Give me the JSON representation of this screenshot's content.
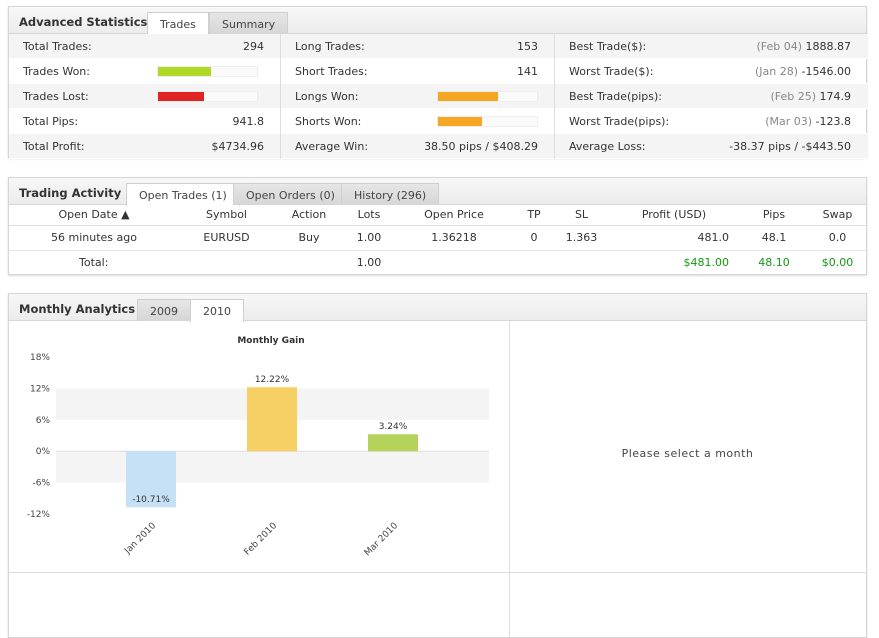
{
  "stats": {
    "title": "Advanced Statistics",
    "tabs": [
      "Trades",
      "Summary"
    ],
    "col1": [
      {
        "label": "Total Trades:",
        "value": "294"
      },
      {
        "label": "Trades Won:",
        "bar": 0.54,
        "color": "#b0d826"
      },
      {
        "label": "Trades Lost:",
        "bar": 0.46,
        "color": "#e02424"
      },
      {
        "label": "Total Pips:",
        "value": "941.8"
      },
      {
        "label": "Total Profit:",
        "value": "$4734.96"
      }
    ],
    "col2": [
      {
        "label": "Long Trades:",
        "value": "153"
      },
      {
        "label": "Short Trades:",
        "value": "141"
      },
      {
        "label": "Longs Won:",
        "bar": 0.61,
        "color": "#f5a623"
      },
      {
        "label": "Shorts Won:",
        "bar": 0.44,
        "color": "#f5a623"
      },
      {
        "label": "Average Win:",
        "value": "38.50 pips / $408.29"
      }
    ],
    "col3": [
      {
        "label": "Best Trade($):",
        "date": "(Feb 04)",
        "value": "1888.87"
      },
      {
        "label": "Worst Trade($):",
        "date": "(Jan 28)",
        "value": "-1546.00"
      },
      {
        "label": "Best Trade(pips):",
        "date": "(Feb 25)",
        "value": "174.9"
      },
      {
        "label": "Worst Trade(pips):",
        "date": "(Mar 03)",
        "value": "-123.8"
      },
      {
        "label": "Average Loss:",
        "value": "-38.37 pips / -$443.50"
      }
    ]
  },
  "activity": {
    "title": "Trading Activity",
    "tabs": [
      "Open Trades (1)",
      "Open Orders (0)",
      "History (296)"
    ],
    "columns": [
      "Open Date ▲",
      "Symbol",
      "Action",
      "Lots",
      "Open Price",
      "TP",
      "SL",
      "Profit (USD)",
      "Pips",
      "Swap"
    ],
    "rows": [
      [
        "56 minutes ago",
        "EURUSD",
        "Buy",
        "1.00",
        "1.36218",
        "0",
        "1.363",
        "481.0",
        "48.1",
        "0.0"
      ]
    ],
    "total": {
      "label": "Total:",
      "lots": "1.00",
      "profit": "$481.00",
      "pips": "48.10",
      "swap": "$0.00"
    }
  },
  "monthly": {
    "title": "Monthly Analytics",
    "tabs": [
      "2009",
      "2010"
    ],
    "placeholder": "Please select a month"
  },
  "chart_data": {
    "type": "bar",
    "title": "Monthly Gain",
    "categories": [
      "Jan 2010",
      "Feb 2010",
      "Mar 2010"
    ],
    "values": [
      -10.71,
      12.22,
      3.24
    ],
    "labels": [
      "-10.71%",
      "12.22%",
      "3.24%"
    ],
    "colors": [
      "#c6e0f5",
      "#f6d062",
      "#b5d35a"
    ],
    "ylim": [
      -12,
      18
    ],
    "yticks": [
      "18%",
      "12%",
      "6%",
      "0%",
      "-6%",
      "-12%"
    ],
    "ytick_values": [
      18,
      12,
      6,
      0,
      -6,
      -12
    ],
    "grid": true
  }
}
